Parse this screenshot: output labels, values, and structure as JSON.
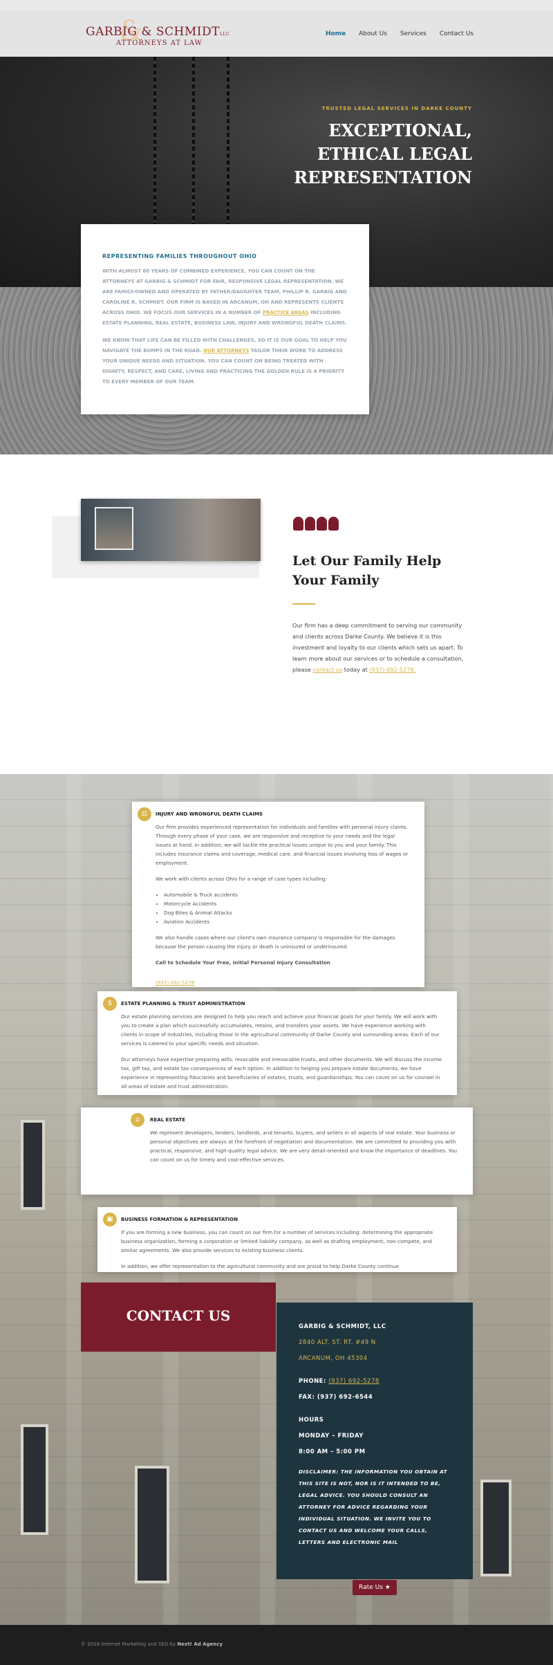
{
  "brand": {
    "name": "GARBIG & SCHMIDT",
    "suffix": "LLC",
    "subtitle": "ATTORNEYS AT LAW",
    "accent": "#7b1c2c",
    "gold": "#d9b54a",
    "navy": "#1e3540"
  },
  "nav": [
    "Home",
    "About Us",
    "Services",
    "Contact Us"
  ],
  "hero": {
    "kicker": "TRUSTED LEGAL SERVICES IN DARKE COUNTY",
    "title_lines": [
      "EXCEPTIONAL,",
      "ETHICAL LEGAL",
      "REPRESENTATION"
    ],
    "card_title": "REPRESENTING FAMILIES THROUGHOUT OHIO",
    "para1_a": "WITH ALMOST 60 YEARS OF COMBINED EXPERIENCE, YOU CAN COUNT ON THE ATTORNEYS AT GARBIG & SCHMIDT FOR FAIR, RESPONSIVE LEGAL REPRESENTATION. WE ARE FAMILY-OWNED AND OPERATED BY FATHER/DAUGHTER TEAM, PHILLIP R. GARBIG AND CAROLINE R. SCHMIDT. OUR FIRM IS BASED IN ARCANUM, OH AND REPRESENTS CLIENTS ACROSS OHIO. WE FOCUS OUR SERVICES IN A NUMBER OF ",
    "para1_link": "PRACTICE AREAS",
    "para1_b": " INCLUDING ESTATE PLANNING, REAL ESTATE, BUSINESS LAW, INJURY AND WRONGFUL DEATH CLAIMS.",
    "para2_a": "WE KNOW THAT LIFE CAN BE FILLED WITH CHALLENGES, SO IT IS OUR GOAL TO HELP YOU NAVIGATE THE BUMPS IN THE ROAD. ",
    "para2_link": "OUR ATTORNEYS",
    "para2_b": " TAILOR THEIR WORK TO ADDRESS YOUR UNIQUE NEEDS AND SITUATION. YOU CAN COUNT ON BEING TREATED WITH DIGNITY, RESPECT, AND CARE, LIVING AND PRACTICING THE GOLDEN RULE IS A PRIORITY TO EVERY MEMBER OF OUR TEAM."
  },
  "family": {
    "title": "Let Our Family Help Your Family",
    "text_a": "Our firm has a deep commitment to serving our community and clients across Darke County. We believe it is this investment and loyalty to our clients which sets us apart. To learn more about our services or to schedule a consultation, please ",
    "link": "contact us",
    "text_b": " today at ",
    "phone": "(937) 692-5278."
  },
  "services": [
    {
      "icon": "scales-icon",
      "title": "INJURY AND WRONGFUL DEATH CLAIMS",
      "p1": "Our firm provides experienced representation for individuals and families with personal injury claims. Through every phase of your case, we are responsive and receptive to your needs and the legal issues at hand. In addition, we will tackle the practical issues unique to you and your family. This includes insurance claims and coverage, medical care, and financial issues involving loss of wages or employment.",
      "p2": "We work with clients across Ohio for a range of case types including:",
      "list": [
        "Automobile & Truck accidents",
        "Motorcycle Accidents",
        "Dog Bites & Animal Attacks",
        "Aviation Accidents"
      ],
      "p3": "We also handle cases where our client's own insurance company is responsible for the damages because the person causing the injury or death is uninsured or underinsured.",
      "cta": "Call to Schedule Your Free, Initial Personal Injury Consultation",
      "phone": "(937) 692-5278"
    },
    {
      "icon": "coin-icon",
      "title": "ESTATE PLANNING & TRUST ADMINISTRATION",
      "p1": "Our estate planning services are designed to help you reach and achieve your financial goals for your family. We will work with you to create a plan which successfully accumulates, retains, and transfers your assets. We have experience working with clients in scope of industries, including those in the agricultural community of Darke County and surrounding areas. Each of our services is catered to your specific needs and situation.",
      "p2": "Our attorneys have expertise preparing wills, revocable and irrevocable trusts, and other documents. We will discuss the income tax, gift tax, and estate tax consequences of each option. In addition to helping you prepare estate documents, we have experience in representing fiduciaries and beneficiaries of estates, trusts, and guardianships. You can count on us for counsel in all areas of estate and trust administration."
    },
    {
      "icon": "home-icon",
      "title": "REAL ESTATE",
      "p1": "We represent developers, lenders, landlords, and tenants, buyers, and sellers in all aspects of real estate. Your business or personal objectives are always at the forefront of negotiation and documentation. We are committed to providing you with practical, responsive, and high-quality legal advice. We are very detail-oriented and know the importance of deadlines. You can count on us for timely and cost-effective services."
    },
    {
      "icon": "briefcase-icon",
      "title": "BUSINESS FORMATION & REPRESENTATION",
      "p1": "If you are forming a new business, you can count on our firm for a number of services including: determining the appropriate business organization, forming a corporation or limited liability company, as well as drafting employment, non-compete, and similar agreements. We also provide services to existing business clients.",
      "p2": "In addition, we offer representation to the agricultural community and are proud to help Darke County continue"
    }
  ],
  "contact": {
    "heading": "CONTACT US",
    "firm": "GARBIG & SCHMIDT, LLC",
    "address1": "2840 ALT. ST. RT. #49 N",
    "address2": "ARCANUM, OH 45304",
    "phone_label": "PHONE:",
    "phone": "(937) 692-5278",
    "fax": "FAX: (937) 692-6544",
    "hours_label": "HOURS",
    "days": "MONDAY – FRIDAY",
    "time": "8:00 AM – 5:00 PM",
    "disclaimer": "DISCLAIMER: THE INFORMATION YOU OBTAIN AT THIS SITE IS NOT, NOR IS IT INTENDED TO BE, LEGAL ADVICE. YOU SHOULD CONSULT AN ATTORNEY FOR ADVICE REGARDING YOUR INDIVIDUAL SITUATION. WE INVITE YOU TO CONTACT US AND WELCOME YOUR CALLS, LETTERS AND ELECTRONIC MAIL",
    "rate_label": "Rate Us ★"
  },
  "footer": {
    "text": "© 2018 Internet Marketing and SEO by ",
    "agency": "Next! Ad Agency"
  }
}
